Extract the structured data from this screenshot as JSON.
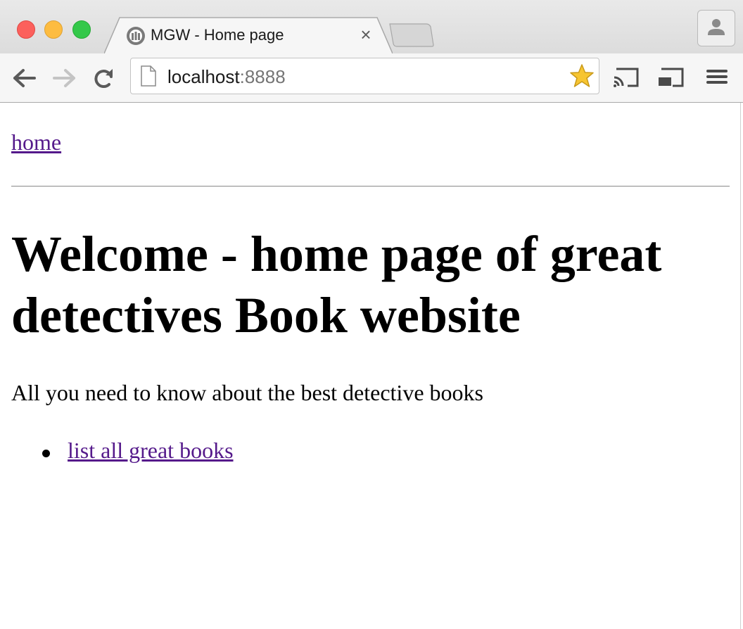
{
  "browser": {
    "tab": {
      "title": "MGW - Home page",
      "close_glyph": "×",
      "favicon": "site-favicon-icon"
    },
    "address_bar": {
      "host": "localhost",
      "port": ":8888"
    },
    "icons": [
      "back-arrow-icon",
      "forward-arrow-icon",
      "reload-icon",
      "page-icon",
      "bookmark-star-icon",
      "cast-icon",
      "cast-screen-icon",
      "menu-icon",
      "profile-icon"
    ],
    "colors": {
      "star": "#f7c531",
      "link": "#551a8b"
    }
  },
  "page": {
    "nav_link": "home",
    "heading": "Welcome - home page of great detectives Book website",
    "lead": "All you need to know about the best detective books",
    "links": [
      {
        "label": "list all great books"
      }
    ]
  }
}
